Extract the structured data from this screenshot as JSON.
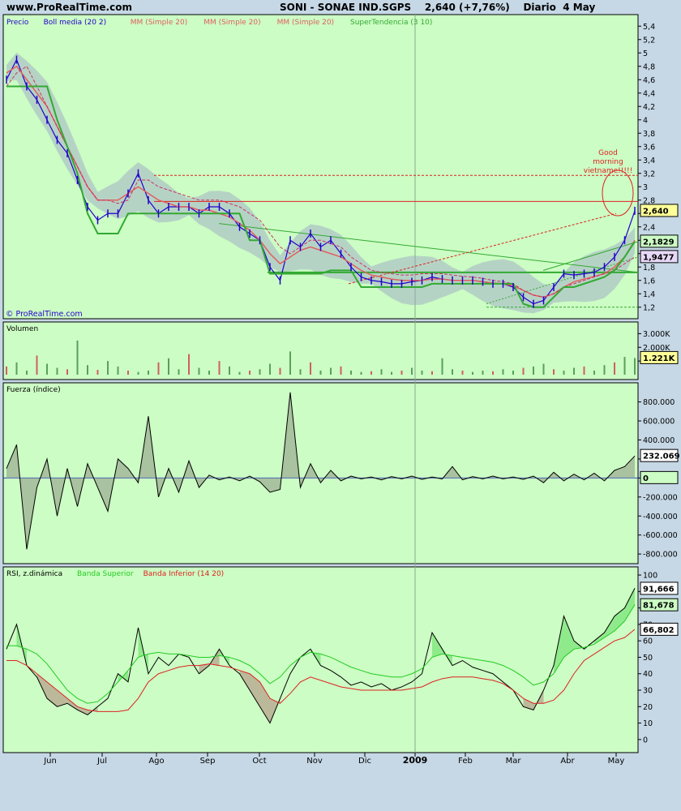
{
  "header": {
    "site": "www.ProRealTime.com",
    "symbol": "SONI - SONAE IND.SGPS",
    "quote": "2,640 (+7,76%)",
    "period": "Diario  4 May"
  },
  "watermark": "© ProRealTime.com",
  "annotation": {
    "line1": "Good",
    "line2": "morning",
    "line3": "vietname!!!!!"
  },
  "colors": {
    "panel_bg": "#ccfdc4",
    "page_bg": "#c6d8e6",
    "price": "#2200cc",
    "boll": "#9aa0c8",
    "mm": "#e06060",
    "supertendencia": "#33aa33",
    "volume": "#5aa05a",
    "volume_red": "#d06060",
    "force_line": "#000000",
    "rsi_upper": "#22cc22",
    "rsi_lower": "#dd2222"
  },
  "chart_data": [
    {
      "type": "line",
      "panel": "price",
      "legend": [
        {
          "label": "Precio",
          "color": "#2200cc"
        },
        {
          "label": "Boll media (20 2)",
          "color": "#2200cc"
        },
        {
          "label": "MM (Simple 20)",
          "color": "#e06060"
        },
        {
          "label": "MM (Simple 20)",
          "color": "#e06060"
        },
        {
          "label": "MM (Simple 20)",
          "color": "#e06060"
        },
        {
          "label": "SuperTendencia (3 10)",
          "color": "#33aa33"
        }
      ],
      "x_labels": [
        "Jun",
        "Jul",
        "Ago",
        "Sep",
        "Oct",
        "Nov",
        "Dic",
        "2009",
        "Feb",
        "Mar",
        "Abr",
        "May"
      ],
      "y_ticks": [
        "5,4",
        "5,2",
        "5",
        "4,8",
        "4,6",
        "4,4",
        "4,2",
        "4",
        "3,8",
        "3,6",
        "3,4",
        "3,2",
        "3",
        "2,8",
        "2,6",
        "2,4",
        "2,2",
        "2",
        "1,8",
        "1,6",
        "1,4",
        "1,2"
      ],
      "ylim": [
        1.1,
        5.5
      ],
      "series": [
        {
          "values": [
            4.6,
            4.9,
            4.5,
            4.3,
            4.0,
            3.7,
            3.5,
            3.1,
            2.7,
            2.5,
            2.6,
            2.6,
            2.9,
            3.2,
            2.8,
            2.6,
            2.7,
            2.7,
            2.7,
            2.6,
            2.7,
            2.7,
            2.6,
            2.4,
            2.3,
            2.2,
            1.8,
            1.6,
            2.2,
            2.1,
            2.3,
            2.1,
            2.2,
            2.0,
            1.8,
            1.65,
            1.6,
            1.58,
            1.55,
            1.55,
            1.58,
            1.6,
            1.65,
            1.62,
            1.6,
            1.6,
            1.6,
            1.58,
            1.55,
            1.55,
            1.5,
            1.35,
            1.25,
            1.3,
            1.5,
            1.7,
            1.68,
            1.7,
            1.72,
            1.8,
            1.95,
            2.2,
            2.64
          ]
        },
        {
          "values": [
            4.7,
            4.8,
            4.6,
            4.4,
            4.2,
            3.9,
            3.6,
            3.3,
            3.0,
            2.8,
            2.8,
            2.8,
            2.9,
            3.0,
            2.9,
            2.8,
            2.75,
            2.7,
            2.7,
            2.65,
            2.65,
            2.6,
            2.55,
            2.45,
            2.35,
            2.2,
            2.0,
            1.85,
            1.95,
            2.05,
            2.1,
            2.05,
            2.0,
            1.95,
            1.85,
            1.75,
            1.68,
            1.65,
            1.62,
            1.6,
            1.6,
            1.6,
            1.62,
            1.62,
            1.6,
            1.6,
            1.6,
            1.58,
            1.56,
            1.55,
            1.52,
            1.45,
            1.38,
            1.35,
            1.4,
            1.5,
            1.58,
            1.62,
            1.66,
            1.7,
            1.8,
            1.95,
            2.2
          ]
        },
        {
          "values": [
            4.5,
            4.7,
            4.8,
            4.5,
            4.2,
            3.9,
            3.6,
            3.3,
            3.0,
            2.8,
            2.8,
            2.75,
            2.8,
            3.1,
            3.1,
            3.0,
            2.95,
            2.9,
            2.85,
            2.8,
            2.8,
            2.8,
            2.75,
            2.7,
            2.6,
            2.5,
            2.3,
            2.1,
            2.0,
            2.1,
            2.2,
            2.2,
            2.15,
            2.1,
            1.95,
            1.85,
            1.75,
            1.72,
            1.7,
            1.68,
            1.68,
            1.7,
            1.7,
            1.7,
            1.68,
            1.66,
            1.65,
            1.63,
            1.6,
            1.58,
            1.55,
            1.45,
            1.38,
            1.35,
            1.4,
            1.5,
            1.55,
            1.6,
            1.65,
            1.7,
            1.75,
            1.85,
            1.95
          ]
        },
        {
          "values": [
            4.5,
            4.5,
            4.5,
            4.5,
            4.5,
            4.0,
            3.6,
            3.2,
            2.6,
            2.3,
            2.3,
            2.3,
            2.6,
            2.6,
            2.6,
            2.6,
            2.6,
            2.6,
            2.6,
            2.6,
            2.6,
            2.6,
            2.6,
            2.6,
            2.2,
            2.2,
            1.7,
            1.7,
            1.7,
            1.7,
            1.7,
            1.7,
            1.75,
            1.75,
            1.75,
            1.5,
            1.5,
            1.5,
            1.5,
            1.5,
            1.5,
            1.5,
            1.55,
            1.55,
            1.55,
            1.55,
            1.55,
            1.55,
            1.55,
            1.55,
            1.55,
            1.25,
            1.2,
            1.2,
            1.35,
            1.5,
            1.5,
            1.55,
            1.6,
            1.65,
            1.75,
            1.95,
            2.18
          ]
        }
      ],
      "value_tags": [
        {
          "text": "2,640",
          "value": 2.64,
          "bg": "#ffff99"
        },
        {
          "text": "2,1829",
          "value": 2.18,
          "bg": "#ccfdc4"
        },
        {
          "text": "1,9477",
          "value": 1.95,
          "bg": "#e8d8f8"
        }
      ],
      "reference_lines": [
        {
          "value": 3.17,
          "style": "dashed",
          "color": "#dd2222"
        },
        {
          "value": 2.78,
          "style": "solid",
          "color": "#dd2222"
        },
        {
          "value": 1.72,
          "style": "solid",
          "color": "#33aa33"
        },
        {
          "value": 1.2,
          "style": "dashed",
          "color": "#33aa33"
        }
      ]
    },
    {
      "type": "bar",
      "panel": "volume",
      "title": "Volumen",
      "y_ticks": [
        "3.000K",
        "2.000K",
        "1.000K"
      ],
      "ylim": [
        0,
        3500
      ],
      "value_tag": "1.221K",
      "values": [
        600,
        900,
        300,
        1400,
        800,
        500,
        400,
        2500,
        700,
        350,
        1000,
        600,
        300,
        200,
        300,
        900,
        1200,
        400,
        1500,
        500,
        300,
        1000,
        600,
        200,
        300,
        400,
        800,
        500,
        1700,
        400,
        900,
        300,
        500,
        600,
        300,
        200,
        250,
        400,
        200,
        300,
        500,
        300,
        250,
        1200,
        400,
        300,
        200,
        300,
        250,
        400,
        300,
        500,
        600,
        800,
        400,
        300,
        500,
        600,
        300,
        700,
        900,
        1300,
        1221
      ]
    },
    {
      "type": "area",
      "panel": "force",
      "title": "Fuerza (índice)",
      "y_ticks": [
        "800.000",
        "600.000",
        "400.000",
        "200.000",
        "0",
        "-200.000",
        "-400.000",
        "-600.000",
        "-800.000"
      ],
      "ylim": [
        -850000,
        950000
      ],
      "value_tag": "232.069",
      "zero_tag": "0",
      "values": [
        100000,
        350000,
        -750000,
        -100000,
        200000,
        -400000,
        100000,
        -300000,
        150000,
        -100000,
        -350000,
        200000,
        100000,
        -50000,
        650000,
        -200000,
        100000,
        -150000,
        180000,
        -100000,
        30000,
        -20000,
        10000,
        -30000,
        20000,
        -40000,
        -150000,
        -120000,
        900000,
        -100000,
        150000,
        -50000,
        80000,
        -30000,
        20000,
        -10000,
        10000,
        -20000,
        15000,
        -10000,
        20000,
        -15000,
        10000,
        -10000,
        120000,
        -20000,
        15000,
        -10000,
        20000,
        -10000,
        10000,
        -15000,
        20000,
        -50000,
        60000,
        -30000,
        40000,
        -20000,
        50000,
        -30000,
        80000,
        120000,
        232069
      ]
    },
    {
      "type": "line",
      "panel": "rsi",
      "title": "RSI, z.dinámica",
      "legend": [
        {
          "label": "RSI, z.dinámica",
          "color": "#000000"
        },
        {
          "label": "Banda Superior",
          "color": "#22cc22"
        },
        {
          "label": "Banda Inferior (14 20)",
          "color": "#dd2222"
        }
      ],
      "y_ticks": [
        "100",
        "90",
        "80",
        "70",
        "60",
        "50",
        "40",
        "30",
        "20",
        "10",
        "0"
      ],
      "ylim": [
        -5,
        102
      ],
      "value_tags": [
        {
          "text": "91,666",
          "value": 91.666,
          "bg": "#ffffff"
        },
        {
          "text": "81,678",
          "value": 81.678,
          "bg": "#ccfdc4"
        },
        {
          "text": "66,802",
          "value": 66.802,
          "bg": "#ffffff"
        }
      ],
      "series": [
        {
          "name": "RSI",
          "values": [
            55,
            70,
            45,
            38,
            25,
            20,
            22,
            18,
            15,
            20,
            25,
            40,
            35,
            68,
            40,
            50,
            45,
            52,
            50,
            40,
            45,
            55,
            45,
            40,
            30,
            20,
            10,
            25,
            40,
            50,
            55,
            45,
            42,
            38,
            33,
            35,
            32,
            34,
            30,
            32,
            35,
            40,
            65,
            55,
            45,
            48,
            44,
            42,
            40,
            35,
            30,
            20,
            18,
            30,
            45,
            75,
            60,
            55,
            60,
            65,
            75,
            80,
            92
          ]
        },
        {
          "name": "Banda Superior",
          "values": [
            57,
            57,
            55,
            52,
            46,
            38,
            30,
            25,
            22,
            23,
            28,
            35,
            42,
            50,
            52,
            53,
            52,
            52,
            51,
            50,
            50,
            51,
            50,
            48,
            45,
            40,
            34,
            38,
            45,
            50,
            53,
            52,
            50,
            47,
            44,
            42,
            40,
            39,
            38,
            38,
            40,
            43,
            50,
            52,
            51,
            50,
            49,
            48,
            47,
            45,
            42,
            38,
            33,
            35,
            40,
            50,
            55,
            56,
            58,
            62,
            66,
            72,
            82
          ]
        },
        {
          "name": "Banda Inferior",
          "values": [
            48,
            48,
            45,
            40,
            35,
            30,
            25,
            20,
            18,
            17,
            17,
            17,
            18,
            25,
            35,
            40,
            42,
            44,
            45,
            45,
            46,
            45,
            44,
            42,
            40,
            35,
            25,
            22,
            28,
            35,
            38,
            36,
            34,
            32,
            31,
            30,
            30,
            30,
            30,
            30,
            31,
            32,
            35,
            37,
            38,
            38,
            38,
            37,
            36,
            34,
            30,
            25,
            22,
            22,
            24,
            30,
            40,
            48,
            52,
            56,
            60,
            62,
            67
          ]
        }
      ]
    }
  ]
}
